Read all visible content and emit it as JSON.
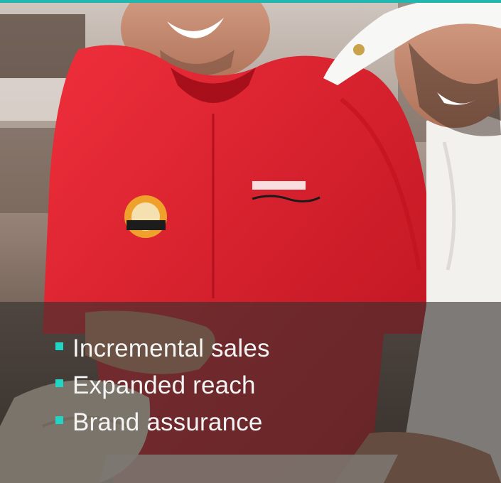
{
  "colors": {
    "accent": "#1fb7b0",
    "bullet": "#21d4c3",
    "shirt": "#dd2330"
  },
  "bullets": [
    {
      "label": "Incremental sales"
    },
    {
      "label": "Expanded reach"
    },
    {
      "label": "Brand assurance"
    }
  ]
}
